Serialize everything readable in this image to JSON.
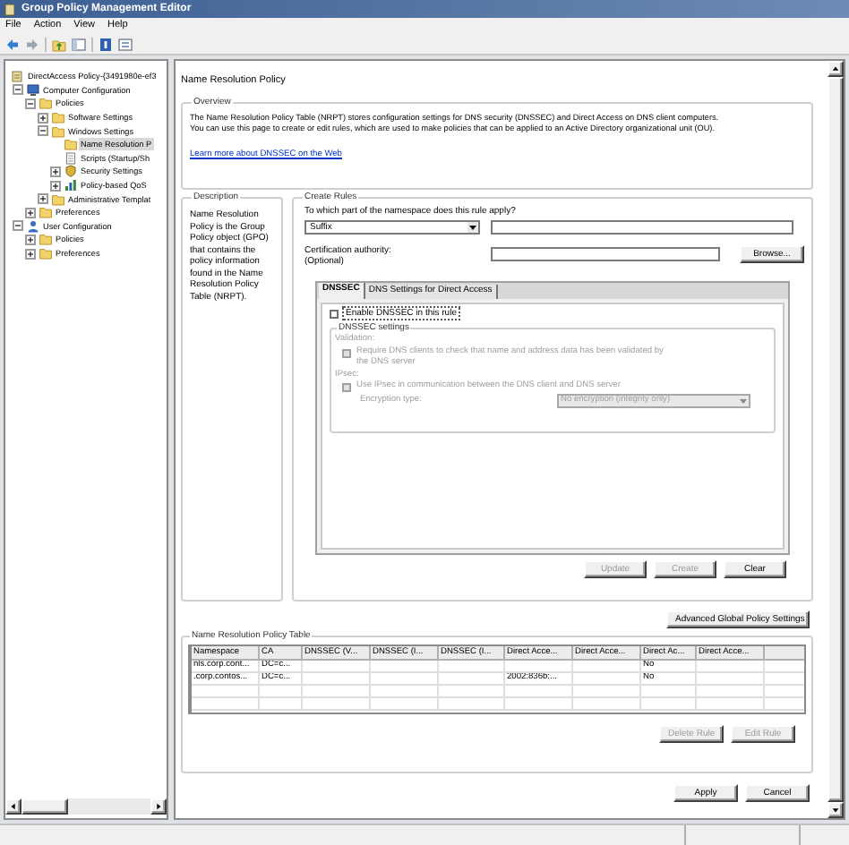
{
  "window": {
    "title": "Group Policy Management Editor"
  },
  "menu": [
    "File",
    "Action",
    "View",
    "Help"
  ],
  "tree": [
    {
      "label": "DirectAccess Policy-{3491980e-ef3",
      "kind": "policy",
      "expander": false,
      "selected": false,
      "children": [
        {
          "label": "Computer Configuration",
          "kind": "computer",
          "expander": true,
          "expanded": true,
          "selected": false,
          "children": [
            {
              "label": "Policies",
              "kind": "folder",
              "expander": true,
              "expanded": true,
              "selected": false,
              "children": [
                {
                  "label": "Software Settings",
                  "kind": "folder",
                  "expander": true,
                  "expanded": false,
                  "selected": false
                },
                {
                  "label": "Windows Settings",
                  "kind": "folder",
                  "expander": true,
                  "expanded": true,
                  "selected": false,
                  "children": [
                    {
                      "label": "Name Resolution P",
                      "kind": "folder",
                      "expander": false,
                      "selected": true
                    },
                    {
                      "label": "Scripts (Startup/Sh",
                      "kind": "script",
                      "expander": false,
                      "selected": false
                    },
                    {
                      "label": "Security Settings",
                      "kind": "security",
                      "expander": true,
                      "expanded": false,
                      "selected": false
                    },
                    {
                      "label": "Policy-based QoS",
                      "kind": "qos",
                      "expander": true,
                      "expanded": false,
                      "selected": false
                    }
                  ]
                },
                {
                  "label": "Administrative Templat",
                  "kind": "folder",
                  "expander": true,
                  "expanded": false,
                  "selected": false
                }
              ]
            },
            {
              "label": "Preferences",
              "kind": "folder",
              "expander": true,
              "expanded": false,
              "selected": false
            }
          ]
        },
        {
          "label": "User Configuration",
          "kind": "user",
          "expander": true,
          "expanded": true,
          "selected": false,
          "children": [
            {
              "label": "Policies",
              "kind": "folder",
              "expander": true,
              "expanded": false,
              "selected": false
            },
            {
              "label": "Preferences",
              "kind": "folder",
              "expander": true,
              "expanded": false,
              "selected": false
            }
          ]
        }
      ]
    }
  ],
  "page": {
    "title": "Name Resolution Policy",
    "overview": {
      "legend": "Overview",
      "lines": [
        "The Name Resolution Policy Table (NRPT) stores configuration settings for DNS security (DNSSEC) and Direct Access on DNS client computers.",
        "You can use this page to create or edit rules, which are used to make policies that can be applied to an Active Directory organizational unit (OU)."
      ],
      "link": "Learn more about DNSSEC on the Web"
    },
    "description": {
      "legend": "Description",
      "text": "Name Resolution Policy is the Group Policy object (GPO) that contains the policy information found in the Name Resolution Policy Table (NRPT)."
    },
    "create_rules": {
      "legend": "Create Rules",
      "question": "To which part of the namespace does this rule apply?",
      "namespace_type": "Suffix",
      "ca_label": "Certification authority:",
      "ca_hint": "(Optional)",
      "browse": "Browse...",
      "tabs": [
        {
          "label": "DNSSEC",
          "selected": true
        },
        {
          "label": "DNS Settings for Direct Access",
          "selected": false
        }
      ],
      "enable": {
        "label": "Enable DNSSEC in this rule",
        "checked": false
      },
      "settings": {
        "legend": "DNSSEC settings",
        "disabled": true,
        "validation_label": "Validation:",
        "require": {
          "label": "Require DNS clients to check that name and address data has been validated by the DNS server",
          "checked": false
        },
        "ipsec_label": "IPsec:",
        "use_ipsec": {
          "label": "Use IPsec in communication between the DNS client and DNS server",
          "checked": false
        },
        "encryption_label": "Encryption type:",
        "encryption_value": "No encryption (integrity only)"
      },
      "buttons": [
        {
          "label": "Update",
          "disabled": true
        },
        {
          "label": "Create",
          "disabled": true
        },
        {
          "label": "Clear",
          "disabled": false
        }
      ]
    },
    "advanced_button": "Advanced Global Policy Settings",
    "table": {
      "legend": "Name Resolution Policy Table",
      "columns": [
        "Namespace",
        "CA",
        "DNSSEC (V...",
        "DNSSEC (I...",
        "DNSSEC (I...",
        "Direct Acce...",
        "Direct Acce...",
        "Direct Ac...",
        "Direct Acce..."
      ],
      "rows": [
        [
          "nls.corp.cont...",
          "DC=c...",
          "",
          "",
          "",
          "",
          "",
          "No",
          ""
        ],
        [
          ".corp.contos...",
          "DC=c...",
          "",
          "",
          "",
          "2002:836b:...",
          "",
          "No",
          ""
        ]
      ]
    },
    "table_buttons": [
      {
        "label": "Delete Rule",
        "disabled": true
      },
      {
        "label": "Edit Rule",
        "disabled": true
      }
    ],
    "footer_buttons": [
      {
        "label": "Apply",
        "disabled": false
      },
      {
        "label": "Cancel",
        "disabled": false
      }
    ]
  }
}
